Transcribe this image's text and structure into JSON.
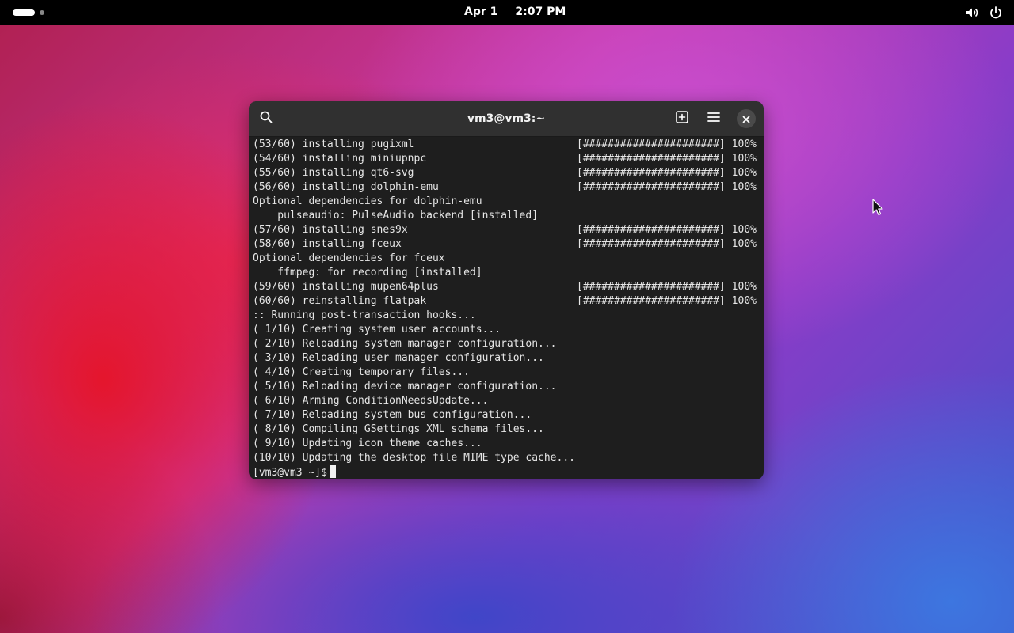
{
  "topbar": {
    "date": "Apr 1",
    "time": "2:07 PM",
    "icons": [
      "activities-indicator",
      "volume-icon",
      "power-icon"
    ]
  },
  "window": {
    "title": "vm3@vm3:~",
    "buttons": [
      "search-icon",
      "new-tab-icon",
      "menu-icon",
      "close-icon"
    ]
  },
  "terminal": {
    "lines": [
      {
        "text": "(53/60) installing pugixml",
        "progress": "[######################] 100%"
      },
      {
        "text": "(54/60) installing miniupnpc",
        "progress": "[######################] 100%"
      },
      {
        "text": "(55/60) installing qt6-svg",
        "progress": "[######################] 100%"
      },
      {
        "text": "(56/60) installing dolphin-emu",
        "progress": "[######################] 100%"
      },
      {
        "text": "Optional dependencies for dolphin-emu",
        "progress": ""
      },
      {
        "text": "    pulseaudio: PulseAudio backend [installed]",
        "progress": ""
      },
      {
        "text": "(57/60) installing snes9x",
        "progress": "[######################] 100%"
      },
      {
        "text": "(58/60) installing fceux",
        "progress": "[######################] 100%"
      },
      {
        "text": "Optional dependencies for fceux",
        "progress": ""
      },
      {
        "text": "    ffmpeg: for recording [installed]",
        "progress": ""
      },
      {
        "text": "(59/60) installing mupen64plus",
        "progress": "[######################] 100%"
      },
      {
        "text": "(60/60) reinstalling flatpak",
        "progress": "[######################] 100%"
      },
      {
        "text": ":: Running post-transaction hooks...",
        "progress": ""
      },
      {
        "text": "( 1/10) Creating system user accounts...",
        "progress": ""
      },
      {
        "text": "( 2/10) Reloading system manager configuration...",
        "progress": ""
      },
      {
        "text": "( 3/10) Reloading user manager configuration...",
        "progress": ""
      },
      {
        "text": "( 4/10) Creating temporary files...",
        "progress": ""
      },
      {
        "text": "( 5/10) Reloading device manager configuration...",
        "progress": ""
      },
      {
        "text": "( 6/10) Arming ConditionNeedsUpdate...",
        "progress": ""
      },
      {
        "text": "( 7/10) Reloading system bus configuration...",
        "progress": ""
      },
      {
        "text": "( 8/10) Compiling GSettings XML schema files...",
        "progress": ""
      },
      {
        "text": "( 9/10) Updating icon theme caches...",
        "progress": ""
      },
      {
        "text": "(10/10) Updating the desktop file MIME type cache...",
        "progress": ""
      }
    ],
    "prompt": "[vm3@vm3 ~]$"
  }
}
